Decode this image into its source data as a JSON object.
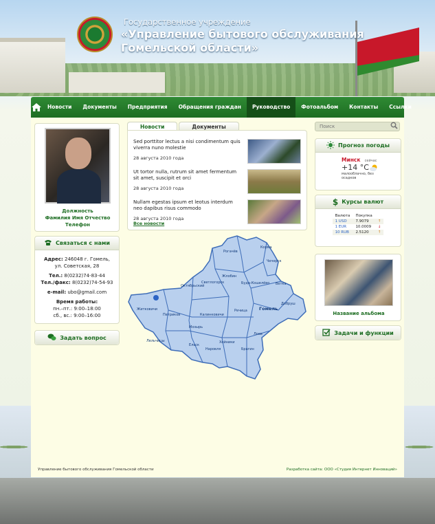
{
  "header": {
    "subtitle": "Государственное учреждение",
    "title_line1": "«Управление бытового обслуживания",
    "title_line2": "Гомельской области»"
  },
  "nav": {
    "items": [
      {
        "label": "Новости",
        "active": false
      },
      {
        "label": "Документы",
        "active": false
      },
      {
        "label": "Предприятия",
        "active": false
      },
      {
        "label": "Обращения граждан",
        "active": false
      },
      {
        "label": "Руководство",
        "active": true
      },
      {
        "label": "Фотоальбом",
        "active": false
      },
      {
        "label": "Контакты",
        "active": false
      },
      {
        "label": "Ссылки",
        "active": false
      }
    ]
  },
  "profile": {
    "position": "Должность",
    "name": "Фамилия Имя Отчество",
    "phone": "Телефон"
  },
  "contact": {
    "title": "Связаться с нами",
    "address_label": "Адрес:",
    "address_line1": "246048 г. Гомель,",
    "address_line2": "ул. Советская, 28",
    "tel_label": "Тел.:",
    "tel": "8(0232)74-83-44",
    "fax_label": "Тел./факс:",
    "fax": "8(0232)74-54-93",
    "email_label": "e-mail:",
    "email": "ubo@gmail.com",
    "hours_title": "Время работы:",
    "hours_weekdays": "пн.–пт.: 9:00–18:00",
    "hours_weekend": "сб., вс.: 9:00–16:00"
  },
  "ask": {
    "label": "Задать вопрос"
  },
  "news": {
    "tabs": [
      "Новости",
      "Документы"
    ],
    "items": [
      {
        "text": "Sed porttitor lectus a nisi condimentum quis viverra nuno molestie",
        "date": "28 августа 2010 года"
      },
      {
        "text": "Ut tortor nulla, rutrum sit amet fermentum sit amet, suscipit et orci",
        "date": "28 августа 2010 года"
      },
      {
        "text": "Nullam egestas ipsum et leotus interdum neo dapibus risus commodo",
        "date": "28 августа 2010 года"
      }
    ],
    "all_label": "Все новости"
  },
  "map": {
    "cities": [
      "Рогачёв",
      "Корма",
      "Чечерск",
      "Жлобин",
      "Буда-Кошелёво",
      "Ветка",
      "Светлогорск",
      "Октябрьский",
      "Речица",
      "Гомель",
      "Добруш",
      "Житковичи",
      "Петриков",
      "Калинковичи",
      "Мозырь",
      "Лоев",
      "Хойники",
      "Лельчицы",
      "Ельск",
      "Наровля",
      "Брагин"
    ]
  },
  "search": {
    "placeholder": "Поиск"
  },
  "weather": {
    "title": "Прогноз погоды",
    "city": "Минск",
    "now_label": "сейчас",
    "temp": "+14 °С",
    "desc_line1": "малооблачно, без",
    "desc_line2": "осадков"
  },
  "currency": {
    "title": "Курсы валют",
    "headers": [
      "Валюта",
      "Покупка"
    ],
    "rows": [
      {
        "code": "1 USD",
        "value": "7.9079",
        "trend": "up"
      },
      {
        "code": "1 EUR",
        "value": "10.0009",
        "trend": "down"
      },
      {
        "code": "10 RUB",
        "value": "2.5120",
        "trend": "up"
      }
    ]
  },
  "album": {
    "title": "Название альбома"
  },
  "tasks": {
    "label": "Задачи и функции"
  },
  "footer": {
    "left": "Управление бытового обслуживания Гомельской области",
    "right": "Разработка сайта:  ООО «Студия Интернет Инноваций»"
  },
  "colors": {
    "accent": "#1d6d22",
    "nav": "#2f8a34",
    "content_bg": "#fdfde5"
  }
}
